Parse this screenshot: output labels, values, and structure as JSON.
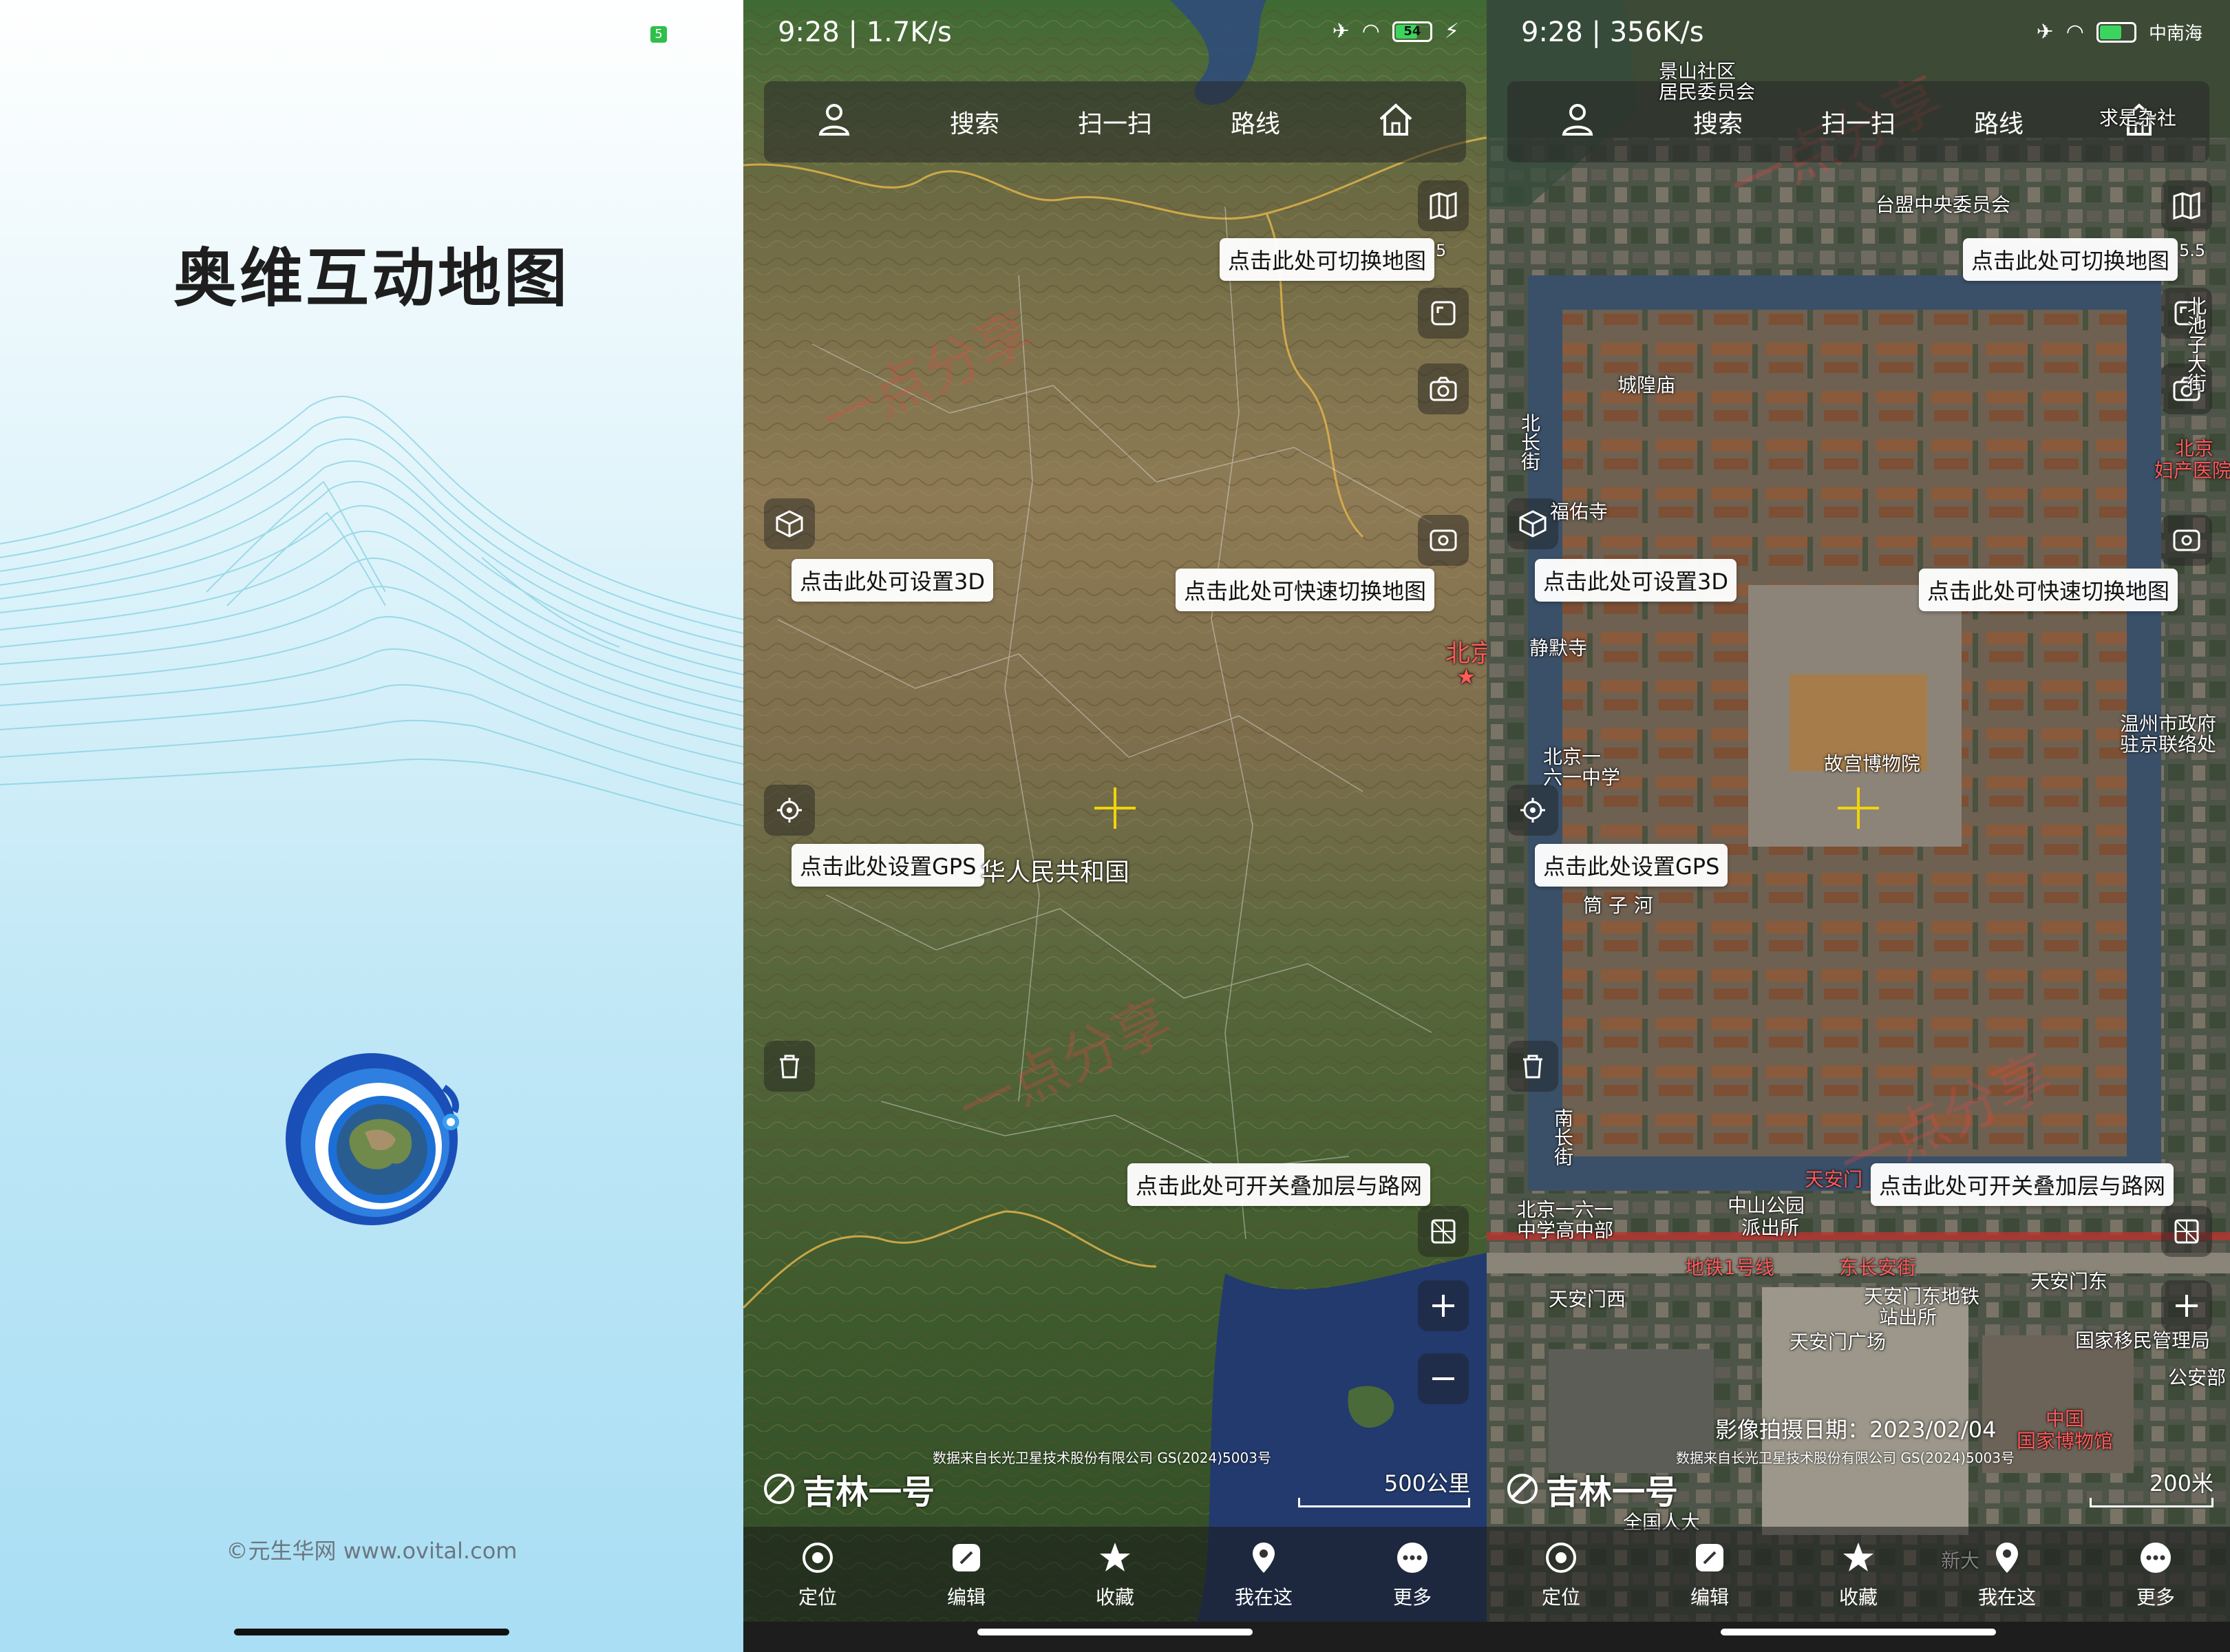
{
  "splash": {
    "title": "奥维互动地图",
    "copyright": "©元生华网 www.ovital.com",
    "badge": "5"
  },
  "watermark": "一点分享",
  "map1": {
    "status": {
      "time": "9:28",
      "speed": "1.7K/s",
      "battery": "54"
    },
    "topbar": {
      "search": "搜索",
      "scan": "扫一扫",
      "route": "路线"
    },
    "tips": {
      "switch_map": "点击此处可切换地图",
      "set_3d": "点击此处可设置3D",
      "quick_switch": "点击此处可快速切换地图",
      "set_gps": "点击此处设置GPS",
      "overlay": "点击此处可开关叠加层与路网"
    },
    "labels": {
      "country": "华人民共和国",
      "beijing": "北京",
      "tip_suffix": "5"
    },
    "attribution": "数据来自长光卫星技术股份有限公司 GS(2024)5003号",
    "brand": "吉林一号",
    "scale": "500公里",
    "nav": {
      "locate": "定位",
      "edit": "编辑",
      "favorite": "收藏",
      "here": "我在这",
      "more": "更多"
    }
  },
  "map2": {
    "status": {
      "time": "9:28",
      "speed": "356K/s",
      "right_text": "中南海"
    },
    "topbar": {
      "search": "搜索",
      "scan": "扫一扫",
      "route": "路线"
    },
    "tips": {
      "switch_map": "点击此处可切换地图",
      "set_3d": "点击此处可设置3D",
      "quick_switch": "点击此处可快速切换地图",
      "set_gps": "点击此处设置GPS",
      "overlay": "点击此处可开关叠加层与路网"
    },
    "labels": {
      "jingshan": "景山社区",
      "jingshan2": "居民委员会",
      "taimeng": "台盟中央委员会",
      "chenghuang": "城隍庙",
      "fuyou": "福佑寺",
      "jingmo": "静默寺",
      "beichang": "北长街",
      "beichizi": "北池子大街",
      "beijing_fuchan": "北京",
      "beijing_fuchan2": "妇产医院",
      "wenzhou": "温州市政府",
      "wenzhou2": "驻京联络处",
      "beijing161": "北京一",
      "beijing161b": "六一中学",
      "gugong": "故宫博物院",
      "tongzi": "筒 子 河",
      "nanchang": "南长街",
      "zhongshan": "中山公园",
      "zhongshan2": "派出所",
      "beijing161c": "北京一六一",
      "beijing161d": "中学高中部",
      "tiananmen": "天安门",
      "ditie": "地铁1号线",
      "changan": "东长安街",
      "tiananmen_xi": "天安门西",
      "tiananmen_dong": "天安门东",
      "ditie_zhan": "天安门东地铁",
      "ditie_zhan2": "站出所",
      "guangchang": "天安门广场",
      "yimin": "国家移民管理局",
      "gonganbu": "公安部",
      "guobo": "中国",
      "guobo2": "国家博物馆",
      "renda": "全国人大",
      "xinda": "新大",
      "tip_suffix": "5.5",
      "qiaoshe": "求是杂社"
    },
    "photo_date": "影像拍摄日期：2023/02/04",
    "attribution": "数据来自长光卫星技术股份有限公司 GS(2024)5003号",
    "brand": "吉林一号",
    "scale": "200米",
    "nav": {
      "locate": "定位",
      "edit": "编辑",
      "favorite": "收藏",
      "here": "我在这",
      "more": "更多"
    }
  }
}
